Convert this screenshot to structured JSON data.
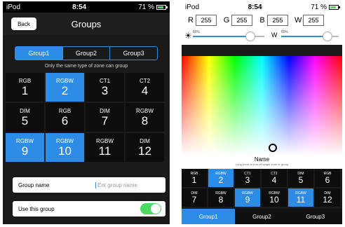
{
  "left": {
    "status": {
      "carrier": "iPod",
      "time": "8:54",
      "battery": "71 %"
    },
    "nav": {
      "back": "Back",
      "title": "Groups"
    },
    "segments": [
      {
        "label": "Group1",
        "active": true
      },
      {
        "label": "Group2",
        "active": false
      },
      {
        "label": "Group3",
        "active": false
      }
    ],
    "hint": "Only the same type of zone can group",
    "zones": [
      {
        "type": "RGB",
        "num": "1",
        "selected": false
      },
      {
        "type": "RGBW",
        "num": "2",
        "selected": true
      },
      {
        "type": "CT1",
        "num": "3",
        "selected": false
      },
      {
        "type": "CT2",
        "num": "4",
        "selected": false
      },
      {
        "type": "DIM",
        "num": "5",
        "selected": false
      },
      {
        "type": "RGB",
        "num": "6",
        "selected": false
      },
      {
        "type": "DIM",
        "num": "7",
        "selected": false
      },
      {
        "type": "RGBW",
        "num": "8",
        "selected": false
      },
      {
        "type": "RGBW",
        "num": "9",
        "selected": true
      },
      {
        "type": "RGBW",
        "num": "10",
        "selected": true
      },
      {
        "type": "RGBW",
        "num": "11",
        "selected": false
      },
      {
        "type": "DIM",
        "num": "12",
        "selected": false
      }
    ],
    "group_name": {
      "label": "Group name",
      "placeholder": "Ent group name"
    },
    "use_group": {
      "label": "Use this group",
      "on": true
    }
  },
  "right": {
    "status": {
      "carrier": "iPod",
      "time": "8:54",
      "battery": "71 %"
    },
    "rgbw": [
      {
        "label": "R",
        "value": "255"
      },
      {
        "label": "G",
        "value": "255"
      },
      {
        "label": "B",
        "value": "255"
      },
      {
        "label": "W",
        "value": "255"
      }
    ],
    "brightness": {
      "icon": "sun-icon",
      "pct_label": "80%",
      "value": 0.8
    },
    "white": {
      "label": "W",
      "pct_label": "80%",
      "value": 0.8
    },
    "name": {
      "title": "Name",
      "subtitle": "Long press to turn off single zone or group"
    },
    "zones": [
      {
        "type": "RGB",
        "num": "1",
        "selected": false
      },
      {
        "type": "RGBW",
        "num": "2",
        "selected": true
      },
      {
        "type": "CT1",
        "num": "3",
        "selected": false
      },
      {
        "type": "CT2",
        "num": "4",
        "selected": false
      },
      {
        "type": "DIM",
        "num": "5",
        "selected": false
      },
      {
        "type": "RGB",
        "num": "6",
        "selected": false
      },
      {
        "type": "DIM",
        "num": "7",
        "selected": false
      },
      {
        "type": "RGBW",
        "num": "8",
        "selected": false
      },
      {
        "type": "RGBW",
        "num": "9",
        "selected": true
      },
      {
        "type": "RGBW",
        "num": "10",
        "selected": false
      },
      {
        "type": "RGBW",
        "num": "11",
        "selected": true
      },
      {
        "type": "DIM",
        "num": "12",
        "selected": false
      }
    ],
    "tabs": [
      {
        "label": "Group1",
        "active": true
      },
      {
        "label": "Group2",
        "active": false
      },
      {
        "label": "Group3",
        "active": false
      }
    ]
  },
  "colors": {
    "accent": "#2d8de6",
    "toggle_on": "#4cd964",
    "cell_bg": "#0d0d0d"
  }
}
